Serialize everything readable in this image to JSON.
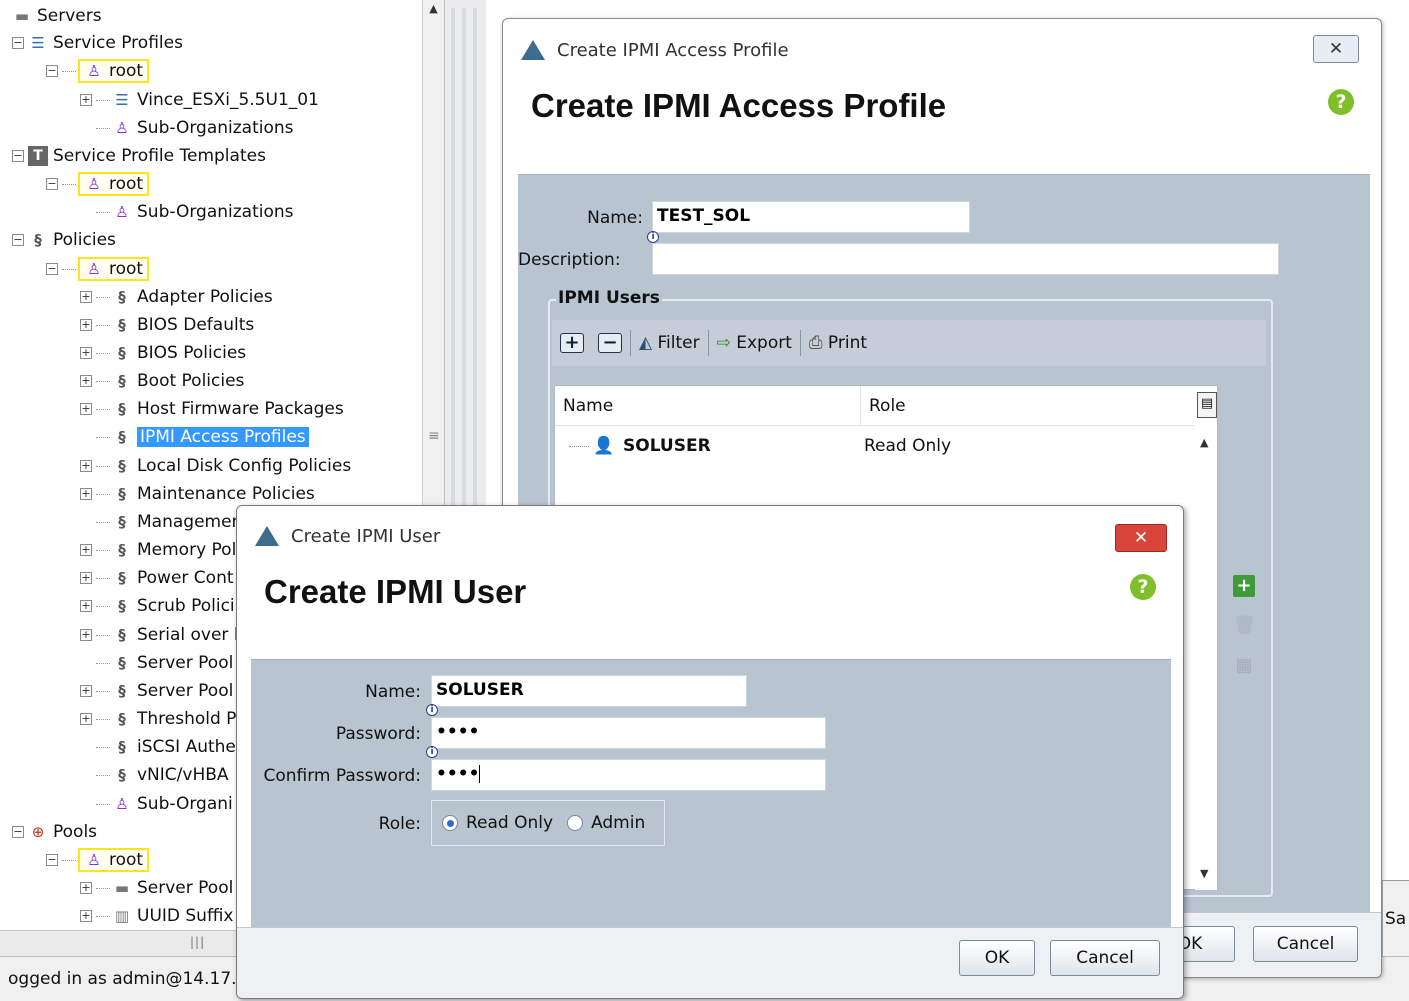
{
  "tree": {
    "servers": "Servers",
    "service_profiles": "Service Profiles",
    "root": "root",
    "vince": "Vince_ESXi_5.5U1_01",
    "sub_orgs": "Sub-Organizations",
    "sp_templates": "Service Profile Templates",
    "policies": "Policies",
    "policy_items": [
      "Adapter Policies",
      "BIOS Defaults",
      "BIOS Policies",
      "Boot Policies",
      "Host Firmware Packages",
      "IPMI Access Profiles",
      "Local Disk Config Policies",
      "Maintenance Policies",
      "Managemen",
      "Memory Pol",
      "Power Cont",
      "Scrub Polici",
      "Serial over l",
      "Server Pool",
      "Server Pool",
      "Threshold P",
      "iSCSI Authe",
      "vNIC/vHBA",
      "Sub-Organi"
    ],
    "pools": "Pools",
    "server_pool": "Server Pool",
    "uuid": "UUID Suffix"
  },
  "status_bar": "ogged in as admin@14.17.",
  "profile_dialog": {
    "window_title": "Create IPMI Access Profile",
    "heading": "Create IPMI Access Profile",
    "name_label": "Name:",
    "name_value": "TEST_SOL",
    "description_label": "Description:",
    "description_value": "",
    "group_title": "IPMI Users",
    "toolbar": {
      "filter": "Filter",
      "export": "Export",
      "print": "Print"
    },
    "columns": [
      "Name",
      "Role"
    ],
    "rows": [
      {
        "name": "SOLUSER",
        "role": "Read Only"
      }
    ],
    "ok": "OK",
    "cancel": "Cancel",
    "edge_text": "Sa"
  },
  "user_dialog": {
    "window_title": "Create IPMI User",
    "heading": "Create IPMI User",
    "name_label": "Name:",
    "name_value": "SOLUSER",
    "password_label": "Password:",
    "password_value": "••••",
    "confirm_label": "Confirm Password:",
    "confirm_value": "••••",
    "role_label": "Role:",
    "role_options": [
      "Read Only",
      "Admin"
    ],
    "role_selected": "Read Only",
    "ok": "OK",
    "cancel": "Cancel"
  }
}
